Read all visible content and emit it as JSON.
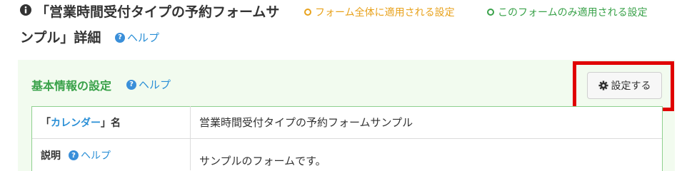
{
  "header": {
    "title_line1": "「営業時間受付タイプの予約フォームサ",
    "title_line2": "ンプル」詳細",
    "help_label": "ヘルプ"
  },
  "legend": {
    "global_label": "フォーム全体に適用される設定",
    "global_color": "#e8a21c",
    "local_label": "このフォームのみ適用される設定",
    "local_color": "#3aa24a"
  },
  "panel": {
    "title": "基本情報の設定",
    "help_label": "ヘルプ",
    "settings_button_label": "設定する"
  },
  "table": {
    "row1": {
      "label_prefix": "「",
      "label_link": "カレンダー",
      "label_suffix": "」名",
      "value": "営業時間受付タイプの予約フォームサンプル"
    },
    "row2": {
      "label": "説明",
      "help_label": "ヘルプ",
      "value": "サンプルのフォームです。"
    }
  }
}
